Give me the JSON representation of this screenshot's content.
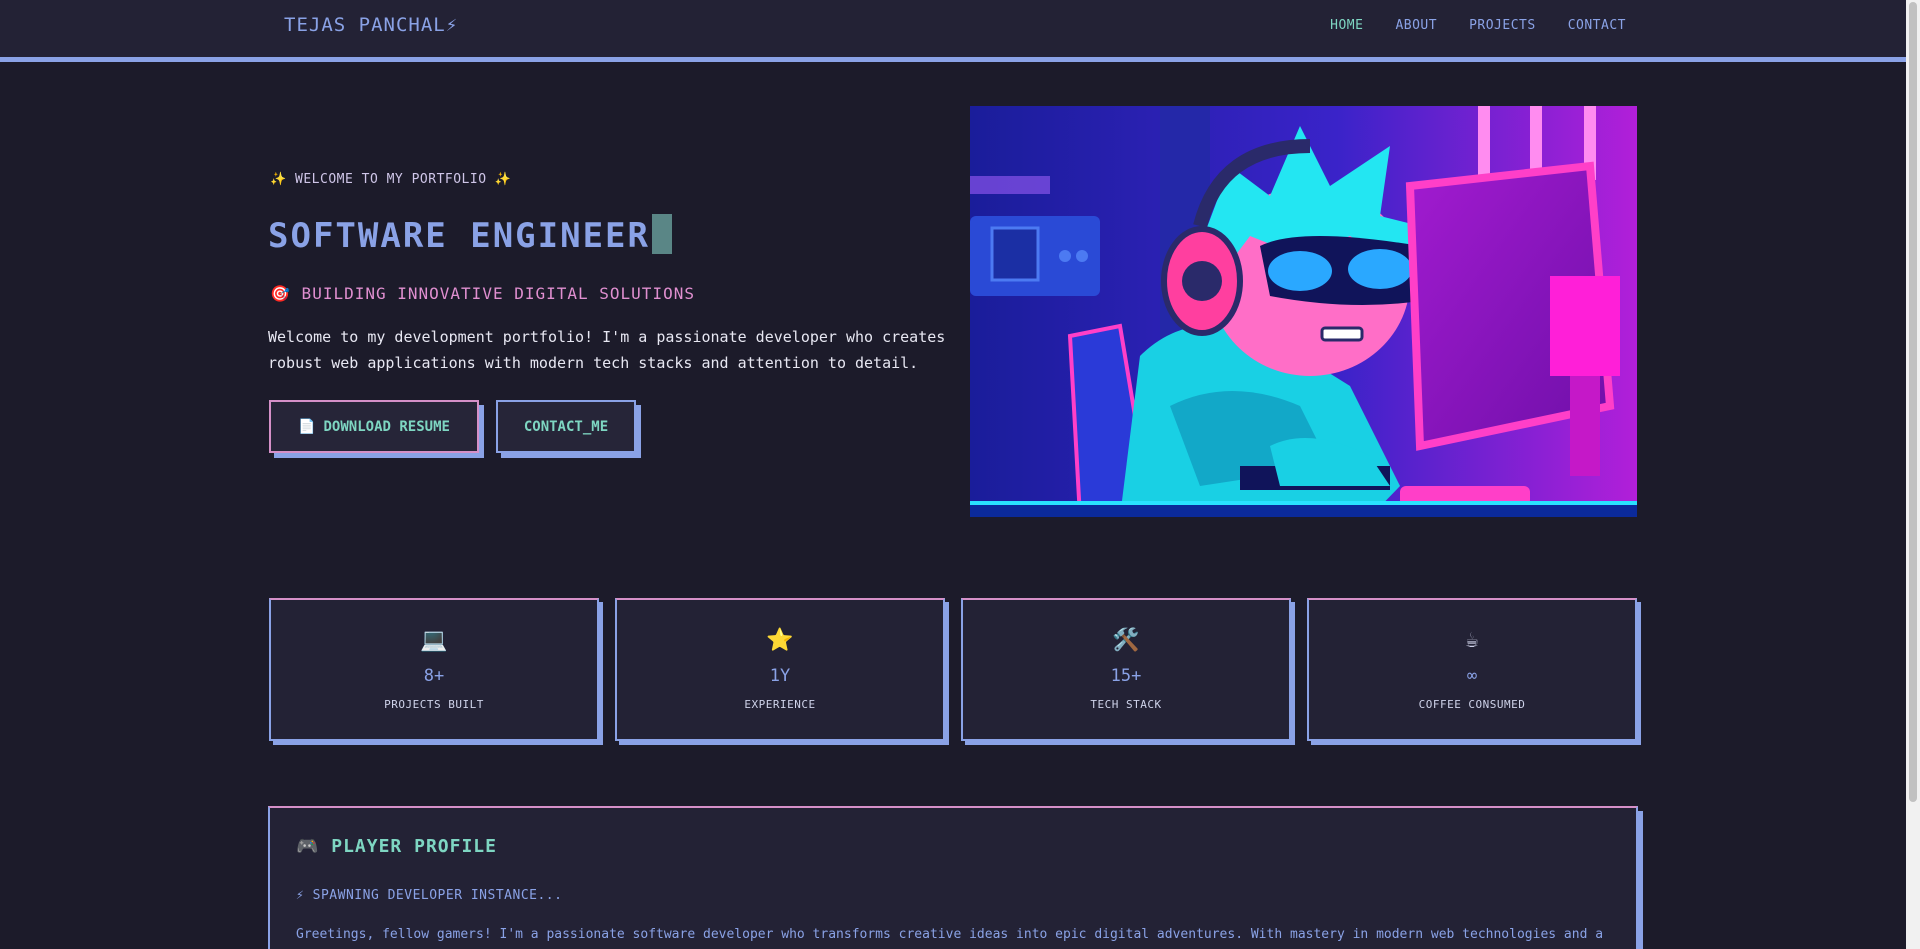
{
  "nav": {
    "brand": "TEJAS PANCHAL⚡",
    "links": [
      "HOME",
      "ABOUT",
      "PROJECTS",
      "CONTACT"
    ]
  },
  "hero": {
    "welcome": "✨ WELCOME TO MY PORTFOLIO ✨",
    "headline": "SOFTWARE ENGINEER",
    "tagline": "🎯 BUILDING INNOVATIVE DIGITAL SOLUTIONS",
    "intro": "Welcome to my development portfolio! I'm a passionate developer who creates robust web applications with modern tech stacks and attention to detail.",
    "resume_icon": "📄",
    "resume_label": "DOWNLOAD RESUME",
    "contact_label": "CONTACT_ME",
    "image_icon": "pixel-art-gamer-illustration"
  },
  "stats": [
    {
      "icon": "💻",
      "icon_name": "laptop-icon",
      "value": "8+",
      "label": "PROJECTS BUILT"
    },
    {
      "icon": "⭐",
      "icon_name": "star-icon",
      "value": "1Y",
      "label": "EXPERIENCE"
    },
    {
      "icon": "🛠️",
      "icon_name": "tools-icon",
      "value": "15+",
      "label": "TECH STACK"
    },
    {
      "icon": "☕",
      "icon_name": "coffee-icon",
      "value": "∞",
      "label": "COFFEE CONSUMED"
    }
  ],
  "profile": {
    "title": "🎮  PLAYER PROFILE",
    "subtitle": "⚡ SPAWNING DEVELOPER INSTANCE...",
    "text": "Greetings, fellow gamers! I'm a passionate software developer who transforms creative ideas into epic digital adventures. With mastery in modern web technologies and a"
  },
  "colors": {
    "background": "#1c1b2a",
    "accent_blue": "#8aa2e6",
    "accent_pink": "#d590c8",
    "accent_teal": "#7ed6c2"
  }
}
